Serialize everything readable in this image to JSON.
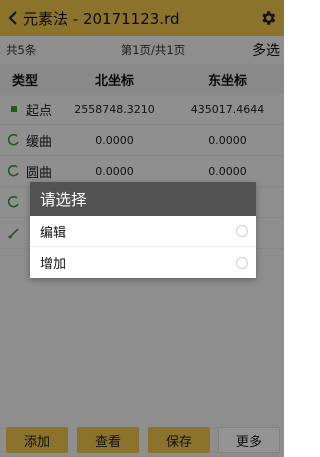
{
  "header": {
    "title": "元素法 - 20171123.rd",
    "back_icon": "chevron-left-icon",
    "settings_icon": "gear-icon"
  },
  "info_bar": {
    "total": "共5条",
    "page": "第1页/共1页",
    "multi_select": "多选"
  },
  "table": {
    "columns": [
      "类型",
      "北坐标",
      "东坐标"
    ],
    "rows": [
      {
        "type": "起点",
        "icon": "start-point-icon",
        "north": "2558748.3210",
        "east": "435017.4644"
      },
      {
        "type": "缓曲",
        "icon": "transition-curve-icon",
        "north": "0.0000",
        "east": "0.0000"
      },
      {
        "type": "圆曲",
        "icon": "circular-curve-icon",
        "north": "0.0000",
        "east": "0.0000"
      },
      {
        "type": "",
        "icon": "curve-icon",
        "north": "",
        "east": ""
      },
      {
        "type": "",
        "icon": "line-icon",
        "north": "",
        "east": ""
      }
    ]
  },
  "dialog": {
    "title": "请选择",
    "options": [
      {
        "label": "编辑"
      },
      {
        "label": "增加"
      }
    ]
  },
  "bottom_bar": {
    "add": "添加",
    "view": "查看",
    "save": "保存",
    "more": "更多"
  },
  "colors": {
    "accent": "#f1c74a",
    "dialog_title_bg": "#525252",
    "icon_green": "#3a9a3a"
  }
}
